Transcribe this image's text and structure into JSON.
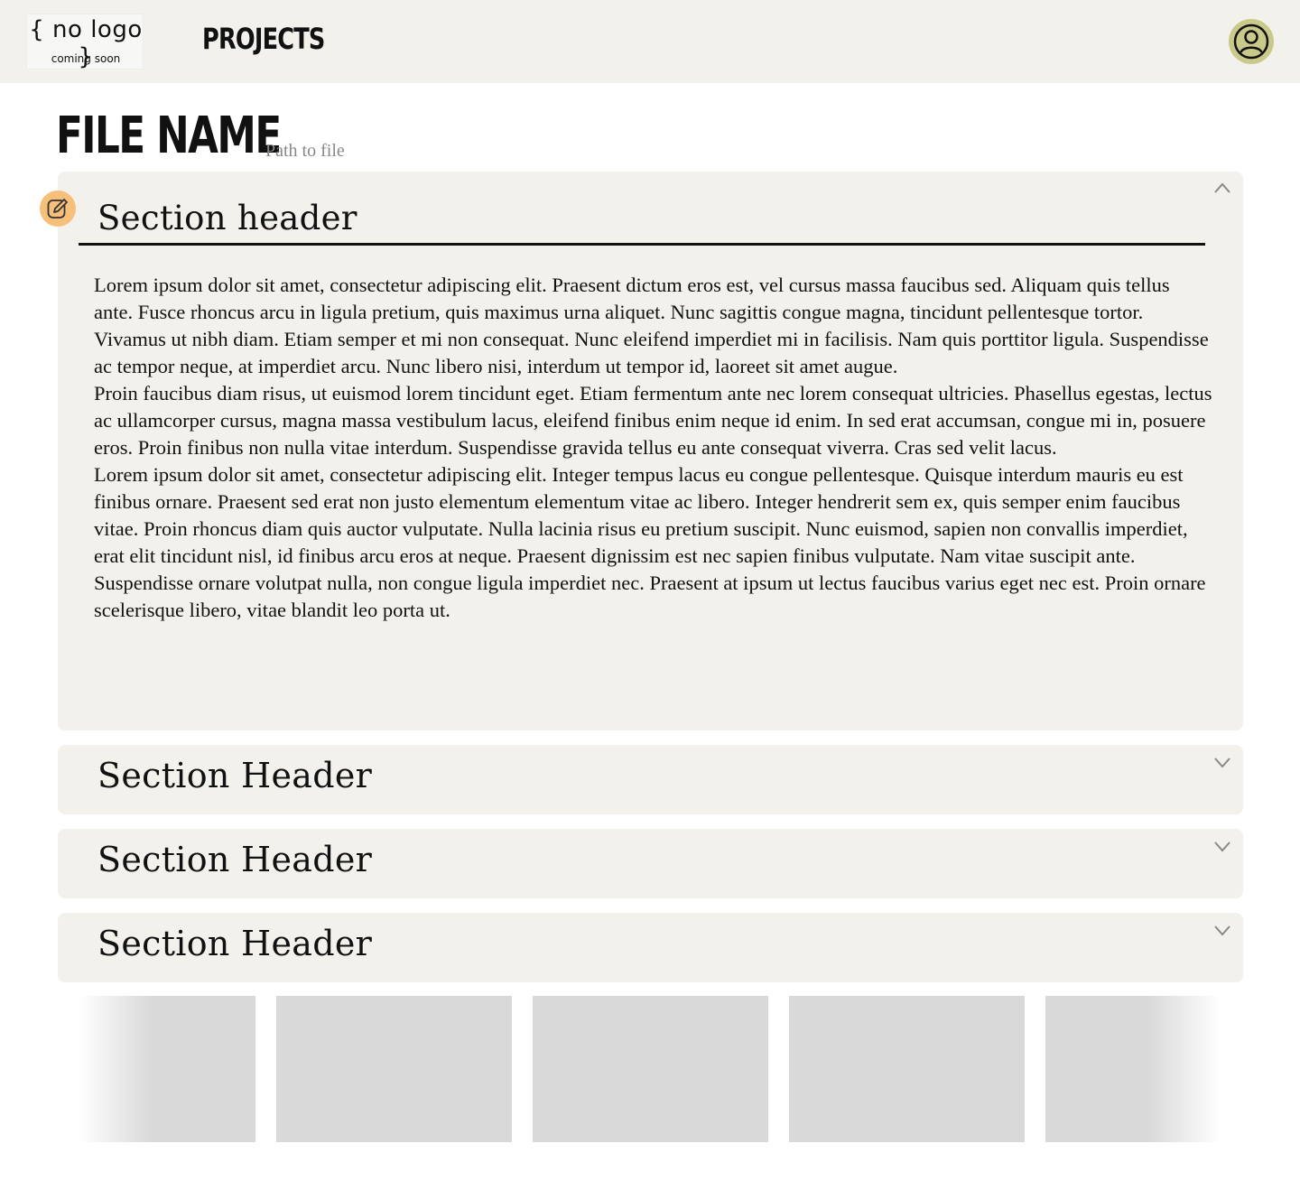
{
  "header": {
    "logo_main": "{ no logo }",
    "logo_sub": "coming soon",
    "nav_title": "PROJECTS",
    "avatar_icon": "user-circle-icon"
  },
  "file": {
    "name": "FILE NAME",
    "path": "Path to file"
  },
  "sections": [
    {
      "title": "Section header",
      "expanded": true,
      "paragraphs": [
        "Lorem ipsum dolor sit amet, consectetur adipiscing elit. Praesent dictum eros est, vel cursus massa faucibus sed. Aliquam quis tellus ante. Fusce rhoncus arcu in ligula pretium, quis maximus urna aliquet. Nunc sagittis congue magna, tincidunt pellentesque tortor. Vivamus ut nibh diam. Etiam semper et mi non consequat. Nunc eleifend imperdiet mi in facilisis. Nam quis porttitor ligula. Suspendisse ac tempor neque, at imperdiet arcu. Nunc libero nisi, interdum ut tempor id, laoreet sit amet augue.",
        "Proin faucibus diam risus, ut euismod lorem tincidunt eget. Etiam fermentum ante nec lorem consequat ultricies. Phasellus egestas, lectus ac ullamcorper cursus, magna massa vestibulum lacus, eleifend finibus enim neque id enim. In sed erat accumsan, congue mi in, posuere eros. Proin finibus non nulla vitae interdum. Suspendisse gravida tellus eu ante consequat viverra. Cras sed velit lacus.",
        "Lorem ipsum dolor sit amet, consectetur adipiscing elit. Integer tempus lacus eu congue pellentesque. Quisque interdum mauris eu est finibus ornare. Praesent sed erat non justo elementum elementum vitae ac libero. Integer hendrerit sem ex, quis semper enim faucibus vitae. Proin rhoncus diam quis auctor vulputate. Nulla lacinia risus eu pretium suscipit. Nunc euismod, sapien non convallis imperdiet, erat elit tincidunt nisl, id finibus arcu eros at neque. Praesent dignissim est nec sapien finibus vulputate. Nam vitae suscipit ante. Suspendisse ornare volutpat nulla, non congue ligula imperdiet nec. Praesent at ipsum ut lectus faucibus varius eget nec est. Proin ornare scelerisque libero, vitae blandit leo porta ut."
      ]
    },
    {
      "title": "Section Header",
      "expanded": false
    },
    {
      "title": "Section Header",
      "expanded": false
    },
    {
      "title": "Section Header",
      "expanded": false
    }
  ],
  "icons": {
    "edit": "pencil-edit-icon",
    "collapse": "chevron-up-icon",
    "expand": "chevron-down-icon"
  },
  "colors": {
    "panel_bg": "#f3f1eb",
    "edit_button": "#f7c07a",
    "avatar_bg": "#c9ca8a",
    "placeholder_card": "#d9d9d9"
  },
  "carousel": {
    "card_count": 5
  }
}
